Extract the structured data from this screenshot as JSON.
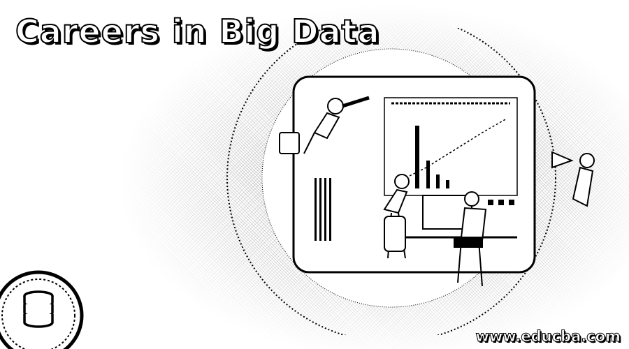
{
  "title": "Careers in Big Data",
  "watermark": "www.educba.com",
  "icons": {
    "badge": "database-icon",
    "illustration": "data-analytics-illustration"
  },
  "colors": {
    "ink": "#000000",
    "paper": "#ffffff"
  }
}
